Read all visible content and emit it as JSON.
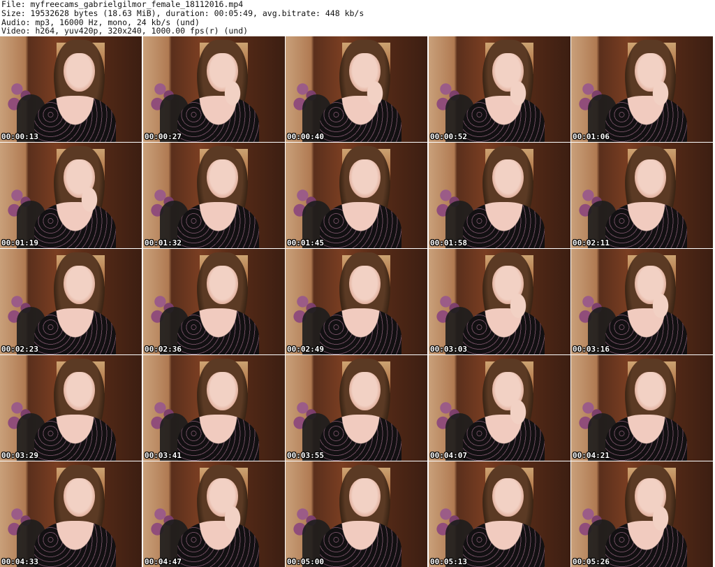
{
  "header": {
    "line1": "File: myfreecams_gabrielgilmor_female_18112016.mp4",
    "line2": "Size: 19532628 bytes (18.63 MiB), duration: 00:05:49, avg.bitrate: 448 kb/s",
    "line3": "Audio: mp3, 16000 Hz, mono, 24 kb/s (und)",
    "line4": "Video: h264, yuv420p, 320x240, 1000.00 fps(r) (und)"
  },
  "thumbnails": [
    {
      "time": "00:00:13",
      "hand": false
    },
    {
      "time": "00:00:27",
      "hand": true
    },
    {
      "time": "00:00:40",
      "hand": true
    },
    {
      "time": "00:00:52",
      "hand": true
    },
    {
      "time": "00:01:06",
      "hand": true
    },
    {
      "time": "00:01:19",
      "hand": true
    },
    {
      "time": "00:01:32",
      "hand": false
    },
    {
      "time": "00:01:45",
      "hand": false
    },
    {
      "time": "00:01:58",
      "hand": false
    },
    {
      "time": "00:02:11",
      "hand": false
    },
    {
      "time": "00:02:23",
      "hand": false
    },
    {
      "time": "00:02:36",
      "hand": false
    },
    {
      "time": "00:02:49",
      "hand": false
    },
    {
      "time": "00:03:03",
      "hand": true
    },
    {
      "time": "00:03:16",
      "hand": true
    },
    {
      "time": "00:03:29",
      "hand": false
    },
    {
      "time": "00:03:41",
      "hand": false
    },
    {
      "time": "00:03:55",
      "hand": false
    },
    {
      "time": "00:04:07",
      "hand": true
    },
    {
      "time": "00:04:21",
      "hand": false
    },
    {
      "time": "00:04:33",
      "hand": false
    },
    {
      "time": "00:04:47",
      "hand": true
    },
    {
      "time": "00:05:00",
      "hand": false
    },
    {
      "time": "00:05:13",
      "hand": false
    },
    {
      "time": "00:05:26",
      "hand": true
    }
  ]
}
